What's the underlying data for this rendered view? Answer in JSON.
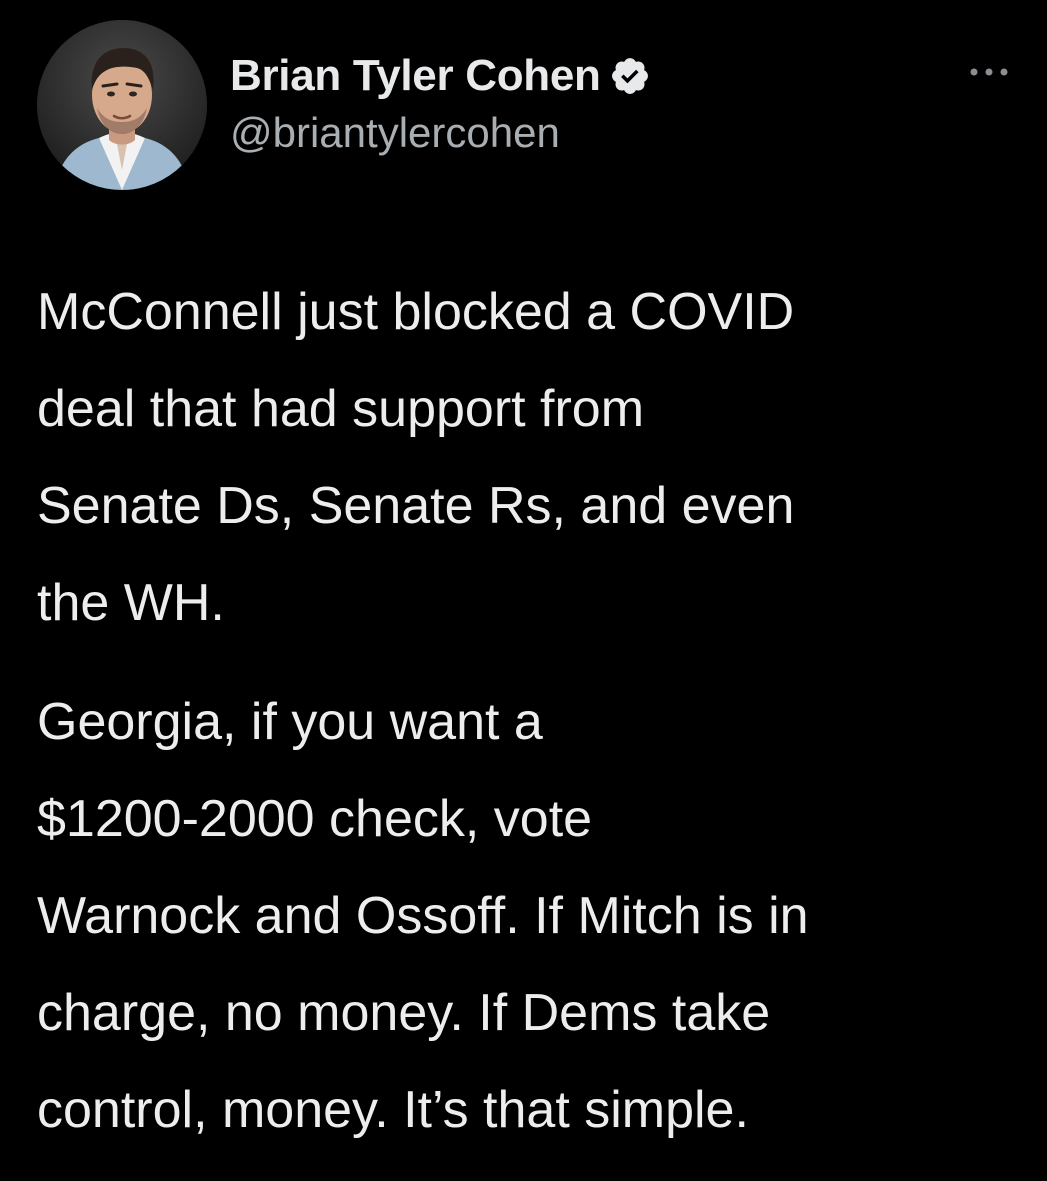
{
  "author": {
    "display_name": "Brian Tyler Cohen",
    "handle": "@briantylercohen",
    "verified": true,
    "avatar_icon": "profile-photo",
    "verified_icon": "verified-badge-icon",
    "more_icon": "more-options-icon"
  },
  "tweet": {
    "paragraphs": [
      {
        "lines": [
          "McConnell just blocked a COVID",
          "deal that had support from",
          "Senate Ds, Senate Rs, and even",
          "the WH."
        ]
      },
      {
        "lines": [
          "Georgia, if you want a",
          "$1200-2000 check, vote",
          "Warnock and Ossoff. If Mitch is in",
          "charge, no money. If Dems take",
          "control, money. It’s that simple."
        ]
      }
    ]
  },
  "colors": {
    "background": "#000000",
    "text": "#e7e9ea",
    "secondary_text": "#a9aeb3"
  }
}
